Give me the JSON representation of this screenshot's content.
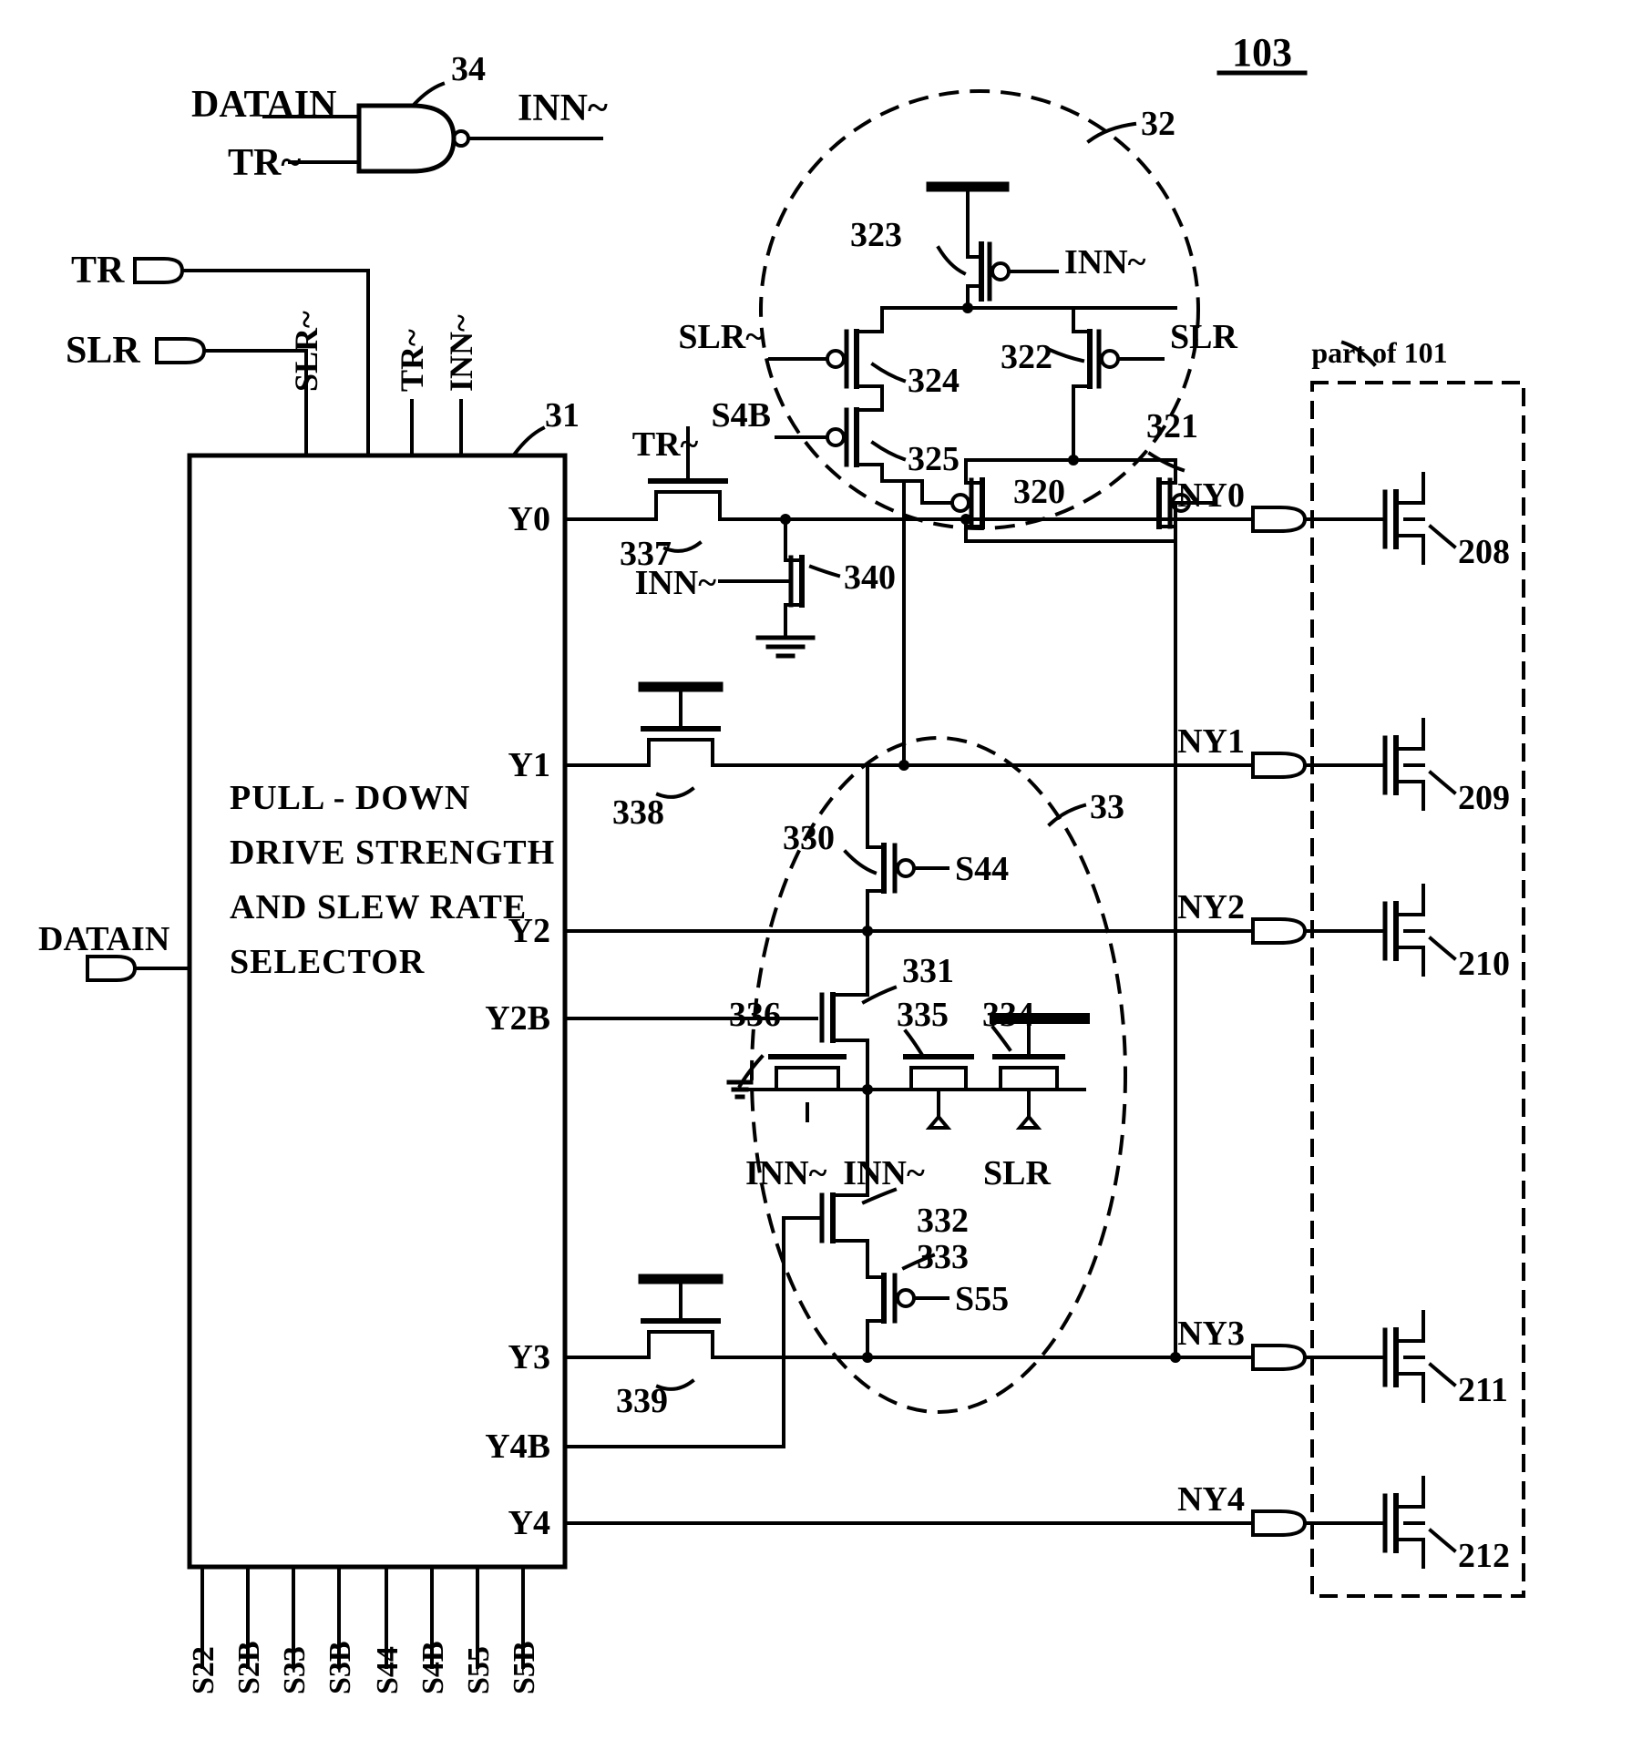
{
  "figure": {
    "number": "103",
    "title_underlined": true
  },
  "nand_gate": {
    "ref": "34",
    "input_top": "DATAIN",
    "input_bottom": "TR~",
    "output": "INN~"
  },
  "input_pins": [
    {
      "name": "TR",
      "id": "input-pin-tr"
    },
    {
      "name": "SLR",
      "id": "input-pin-slr"
    },
    {
      "name": "DATAIN",
      "id": "input-pin-datain"
    }
  ],
  "selector_block": {
    "ref": "31",
    "title_lines": [
      "PULL - DOWN",
      "DRIVE STRENGTH",
      "AND SLEW RATE",
      "SELECTOR"
    ],
    "top_pin_labels": [
      "SLR~",
      "TR~",
      "INN~"
    ],
    "bottom_pin_labels": [
      "S22",
      "S2B",
      "S33",
      "S3B",
      "S44",
      "S4B",
      "S55",
      "S5B"
    ],
    "output_pin_labels": [
      "Y0",
      "Y1",
      "Y2",
      "Y2B",
      "Y3",
      "Y4B",
      "Y4"
    ]
  },
  "dashed_groups": [
    {
      "ref": "32",
      "shape": "circle"
    },
    {
      "ref": "33",
      "shape": "ellipse"
    }
  ],
  "part_of_101": {
    "label": "part of 101",
    "transistors": [
      "208",
      "209",
      "210",
      "211",
      "212"
    ],
    "net_labels": [
      "NY0",
      "NY1",
      "NY2",
      "NY3",
      "NY4"
    ]
  },
  "transistors": [
    {
      "ref": "323",
      "gate": "INN~",
      "type": "pmos"
    },
    {
      "ref": "324",
      "gate": "SLR~",
      "type": "pmos"
    },
    {
      "ref": "325",
      "gate": "S4B",
      "type": "pmos"
    },
    {
      "ref": "322",
      "gate": "SLR",
      "type": "pmos"
    },
    {
      "ref": "321",
      "gate": "",
      "type": "pmos"
    },
    {
      "ref": "320",
      "gate": "",
      "type": "pmos"
    },
    {
      "ref": "337",
      "gate": "TR~",
      "type": "pass"
    },
    {
      "ref": "340",
      "gate": "INN~",
      "type": "nmos"
    },
    {
      "ref": "338",
      "gate": "",
      "type": "pass"
    },
    {
      "ref": "330",
      "gate": "S44",
      "type": "pmos"
    },
    {
      "ref": "331",
      "gate": "",
      "type": "nmos"
    },
    {
      "ref": "336",
      "gate": "INN~",
      "type": "nmos"
    },
    {
      "ref": "335",
      "gate": "INN~",
      "type": "nmos"
    },
    {
      "ref": "334",
      "gate": "SLR",
      "type": "nmos"
    },
    {
      "ref": "332",
      "gate": "",
      "type": "nmos"
    },
    {
      "ref": "333",
      "gate": "S55",
      "type": "pmos"
    },
    {
      "ref": "339",
      "gate": "",
      "type": "pass"
    }
  ],
  "signal_labels": {
    "innn": "INN~",
    "slr_bar": "SLR~",
    "slr": "SLR",
    "tr_bar": "TR~",
    "s4b": "S4B",
    "s44": "S44",
    "s55": "S55"
  },
  "ref_numbers": {
    "n31": "31",
    "n32": "32",
    "n33": "33",
    "n34": "34",
    "n320": "320",
    "n321": "321",
    "n322": "322",
    "n323": "323",
    "n324": "324",
    "n325": "325",
    "n330": "330",
    "n331": "331",
    "n332": "332",
    "n333": "333",
    "n334": "334",
    "n335": "335",
    "n336": "336",
    "n337": "337",
    "n338": "338",
    "n339": "339",
    "n340": "340",
    "n208": "208",
    "n209": "209",
    "n210": "210",
    "n211": "211",
    "n212": "212"
  },
  "colors": {
    "ink": "#000000",
    "paper": "#ffffff"
  }
}
